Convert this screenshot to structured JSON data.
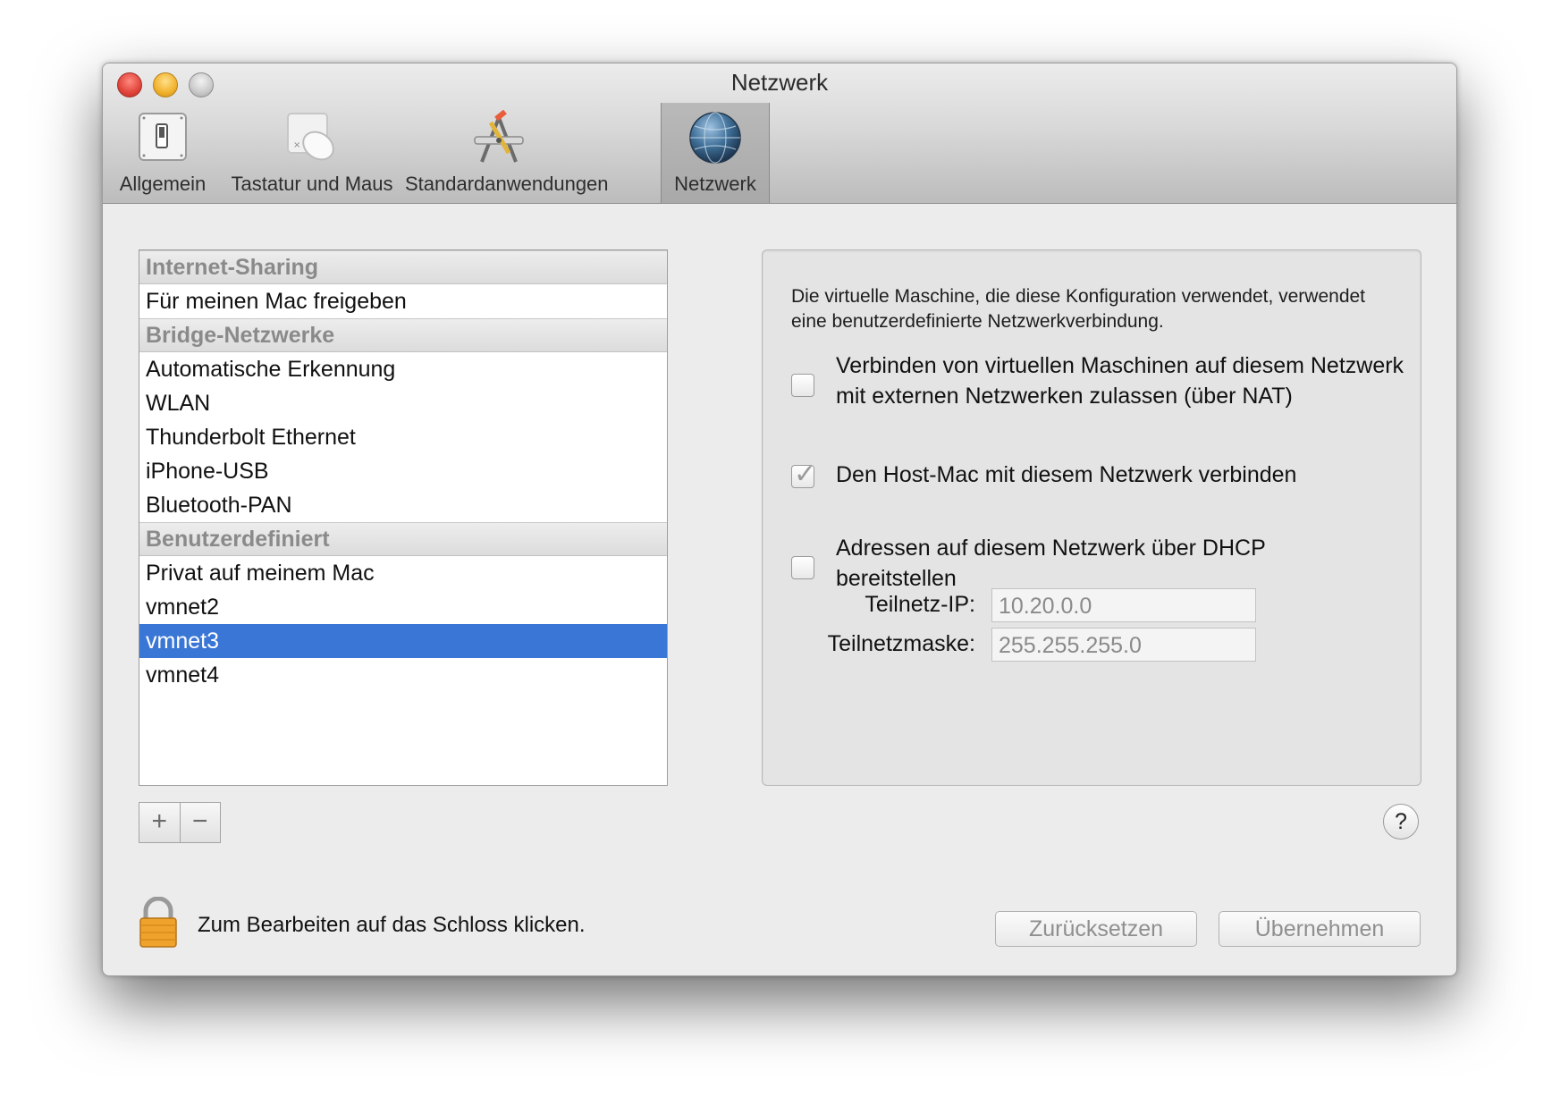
{
  "window": {
    "title": "Netzwerk"
  },
  "toolbar": {
    "items": [
      {
        "label": "Allgemein",
        "icon": "switch-icon"
      },
      {
        "label": "Tastatur und Maus",
        "icon": "mouse-icon"
      },
      {
        "label": "Standardanwendungen",
        "icon": "app-tools-icon"
      },
      {
        "label": "Netzwerk",
        "icon": "globe-icon",
        "selected": true
      }
    ]
  },
  "sidebar": {
    "sections": [
      {
        "header": "Internet-Sharing",
        "items": [
          "Für meinen Mac freigeben"
        ]
      },
      {
        "header": "Bridge-Netzwerke",
        "items": [
          "Automatische Erkennung",
          "WLAN",
          "Thunderbolt Ethernet",
          "iPhone-USB",
          "Bluetooth-PAN"
        ]
      },
      {
        "header": "Benutzerdefiniert",
        "items": [
          "Privat auf meinem Mac",
          "vmnet2",
          "vmnet3",
          "vmnet4"
        ]
      }
    ],
    "selected": "vmnet3",
    "add_label": "+",
    "remove_label": "−"
  },
  "panel": {
    "description": "Die virtuelle Maschine, die diese Konfiguration verwendet, verwendet eine benutzerdefinierte Netzwerkverbindung.",
    "nat": {
      "label": "Verbinden von virtuellen Maschinen auf diesem Netzwerk mit externen Netzwerken zulassen (über NAT)",
      "checked": false
    },
    "host": {
      "label": "Den Host-Mac mit diesem Netzwerk verbinden",
      "checked": true,
      "check_glyph": "✓"
    },
    "dhcp": {
      "label": "Adressen auf diesem Netzwerk über DHCP bereitstellen",
      "checked": false
    },
    "subnet_ip": {
      "label": "Teilnetz-IP:",
      "value": "10.20.0.0"
    },
    "subnet_mask": {
      "label": "Teilnetzmaske:",
      "value": "255.255.255.0"
    }
  },
  "footer": {
    "lock_text": "Zum Bearbeiten auf das Schloss klicken.",
    "reset_label": "Zurücksetzen",
    "apply_label": "Übernehmen",
    "help_label": "?"
  },
  "colors": {
    "selection": "#3a76d6",
    "close": "#e0443a",
    "minimize": "#f1b12c",
    "zoom": "#c9c9c9"
  }
}
